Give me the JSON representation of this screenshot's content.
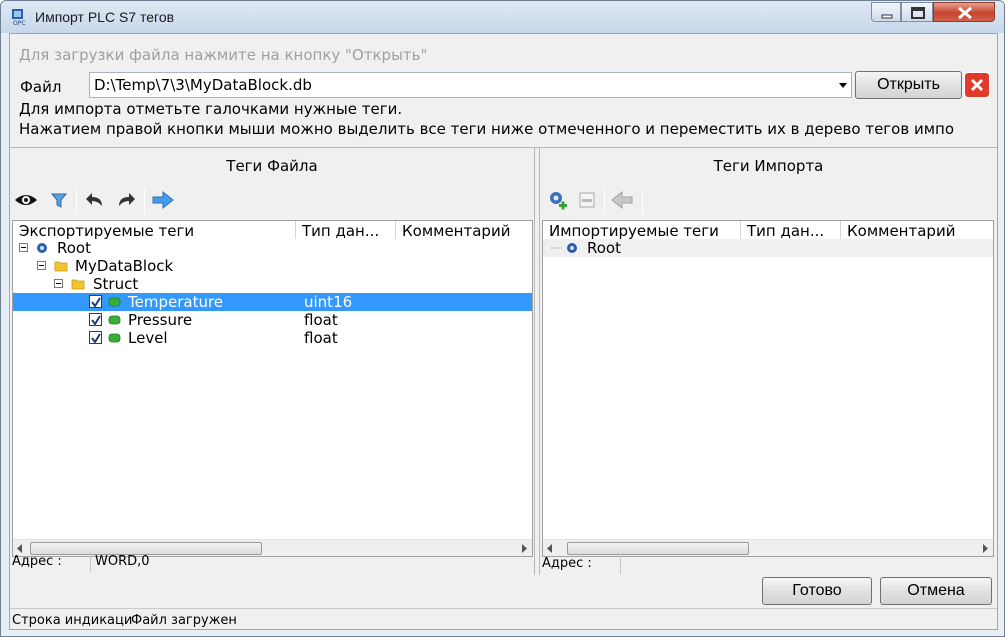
{
  "window": {
    "title": "Импорт PLC S7 тегов"
  },
  "top": {
    "hint": "Для загрузки файла нажмите на кнопку \"Открыть\"",
    "file_label": "Файл",
    "file_path": "D:\\Temp\\7\\3\\MyDataBlock.db",
    "open_button": "Открыть",
    "info_line1": "Для импорта отметьте галочками нужные теги.",
    "info_line2": "Нажатием правой кнопки мыши можно выделить все теги ниже отмеченного и переместить их в дерево тегов импо"
  },
  "left_pane": {
    "title": "Теги Файла",
    "columns": [
      "Экспортируемые теги",
      "Тип дан...",
      "Комментарий"
    ],
    "rows": [
      {
        "name": "Root",
        "type": ""
      },
      {
        "name": "MyDataBlock",
        "type": ""
      },
      {
        "name": "Struct",
        "type": ""
      },
      {
        "name": "Temperature",
        "type": "uint16",
        "checked": true,
        "selected": true
      },
      {
        "name": "Pressure",
        "type": "float",
        "checked": true
      },
      {
        "name": "Level",
        "type": "float",
        "checked": true
      }
    ],
    "address_label": "Адрес :",
    "address_value": "WORD,0"
  },
  "right_pane": {
    "title": "Теги Импорта",
    "columns": [
      "Импортируемые теги",
      "Тип дан...",
      "Комментарий"
    ],
    "rows": [
      {
        "name": "Root"
      }
    ],
    "address_label": "Адрес :",
    "address_value": ""
  },
  "buttons": {
    "done": "Готово",
    "cancel": "Отмена"
  },
  "status": {
    "left": "Строка индикаци",
    "right": "Файл загружен"
  },
  "colors": {
    "selection": "#3399ff",
    "close_button": "#c8452f",
    "tag_icon": "#38b038",
    "folder_icon": "#f4c430"
  },
  "icons": [
    "eye-icon",
    "filter-icon",
    "undo-icon",
    "redo-icon",
    "arrow-right-icon",
    "gear-add-icon",
    "tag-icon",
    "arrow-left-icon"
  ]
}
